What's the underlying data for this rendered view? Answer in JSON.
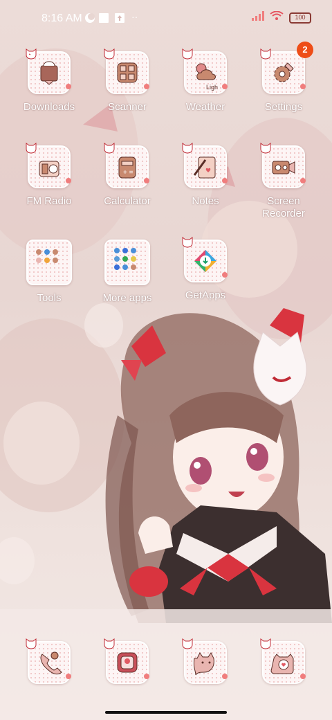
{
  "status_bar": {
    "time": "8:16 AM",
    "icons": [
      "moon-icon",
      "square-icon",
      "arrow-up-box-icon",
      "dots-icon",
      "signal-icon",
      "wifi-icon",
      "battery-icon"
    ],
    "battery_text": "100"
  },
  "apps": [
    {
      "label": "Downloads",
      "icon": "download-icon",
      "badge": ""
    },
    {
      "label": "Scanner",
      "icon": "scanner-icon",
      "badge": ""
    },
    {
      "label": "Weather",
      "icon": "weather-icon",
      "badge": "",
      "sublabel": "Ligh"
    },
    {
      "label": "Settings",
      "icon": "gear-icon",
      "badge": "2"
    },
    {
      "label": "FM Radio",
      "icon": "radio-icon",
      "badge": ""
    },
    {
      "label": "Calculator",
      "icon": "calculator-icon",
      "badge": ""
    },
    {
      "label": "Notes",
      "icon": "notes-icon",
      "badge": ""
    },
    {
      "label": "Screen\nRecorder",
      "icon": "video-camera-icon",
      "badge": ""
    },
    {
      "label": "Tools",
      "icon": "folder-icon",
      "badge": ""
    },
    {
      "label": "More apps",
      "icon": "folder-icon",
      "badge": ""
    },
    {
      "label": "GetApps",
      "icon": "getapps-icon",
      "badge": ""
    }
  ],
  "dock": [
    {
      "icon": "phone-icon"
    },
    {
      "icon": "gallery-icon"
    },
    {
      "icon": "messages-icon"
    },
    {
      "icon": "camera-icon"
    }
  ],
  "colors": {
    "accent": "#d9343f",
    "badge": "#ee4d17",
    "icon_bg": "#fdf5f5",
    "icon_stroke": "#7a3a2e"
  }
}
